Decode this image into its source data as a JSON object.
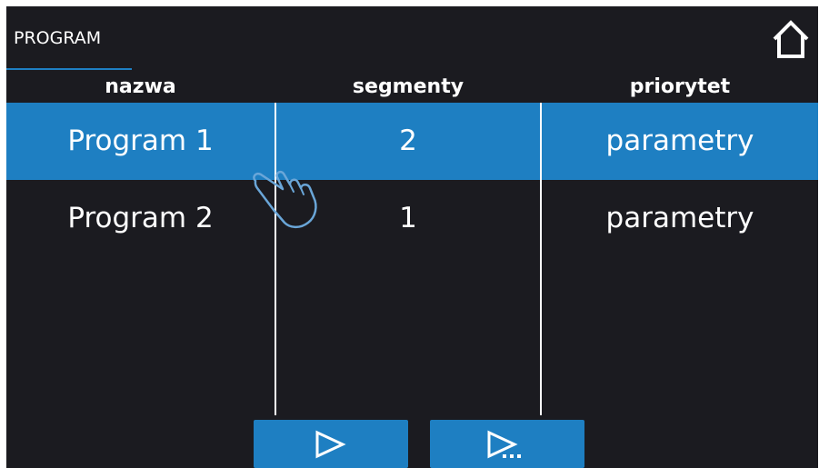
{
  "header": {
    "tab_label": "PROGRAM",
    "home_icon": "home-icon"
  },
  "table": {
    "columns": [
      "nazwa",
      "segmenty",
      "priorytet"
    ],
    "rows": [
      {
        "name": "Program 1",
        "segments": "2",
        "priority": "parameters_placeholder"
      },
      {
        "name": "Program 2",
        "segments": "1",
        "priority": "parameters_placeholder"
      }
    ]
  },
  "buttons": {
    "start_icon": "play-icon",
    "start_options_icon": "play-more-icon"
  },
  "colors": {
    "background": "#1b1b20",
    "accent": "#1e7fc2",
    "text": "#ffffff"
  },
  "selected_row_index": 0,
  "gesture_icon": "tap-hand-icon"
}
